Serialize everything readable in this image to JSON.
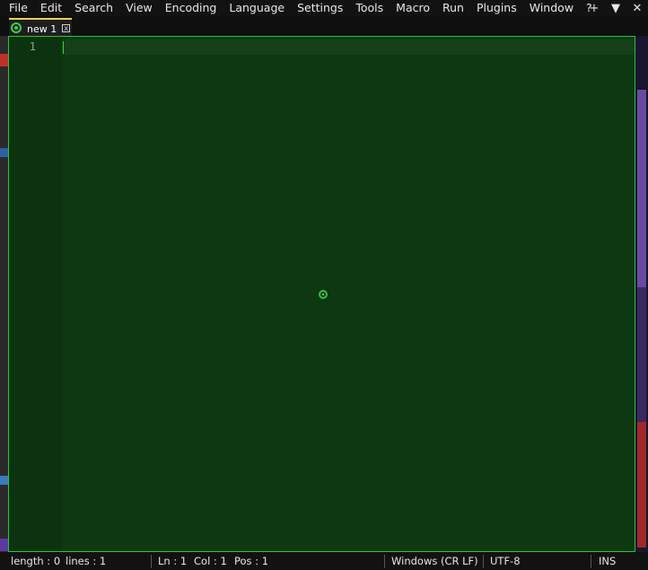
{
  "menu": {
    "items": [
      "File",
      "Edit",
      "Search",
      "View",
      "Encoding",
      "Language",
      "Settings",
      "Tools",
      "Macro",
      "Run",
      "Plugins",
      "Window",
      "?"
    ],
    "right_controls": [
      "+",
      "▼",
      "✕"
    ]
  },
  "tabs": [
    {
      "label": "new 1",
      "close_glyph": "x",
      "icon": "saved-status-icon"
    }
  ],
  "editor": {
    "line_numbers": [
      "1"
    ],
    "content": "",
    "background_color": "#0e3812",
    "border_color": "#2fbf3f"
  },
  "status": {
    "length": "length : 0",
    "lines": "lines : 1",
    "ln": "Ln : 1",
    "col": "Col : 1",
    "pos": "Pos : 1",
    "eol": "Windows (CR LF)",
    "encoding": "UTF-8",
    "mode": "INS"
  },
  "colors": {
    "accent": "#2fbf3f",
    "tab_active_marker": "#f0d24a"
  }
}
